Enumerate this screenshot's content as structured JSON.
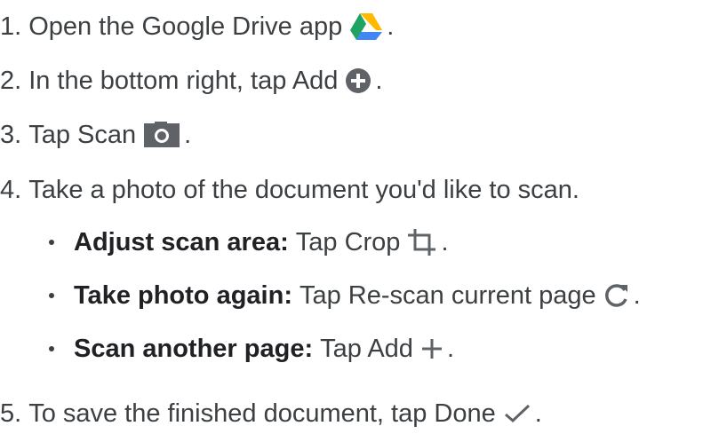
{
  "steps": [
    {
      "num": "1.",
      "text": "Open the Google Drive app",
      "icon": "google-drive-icon",
      "end": "."
    },
    {
      "num": "2.",
      "text": "In the bottom right, tap Add",
      "icon": "add-circle-icon",
      "end": "."
    },
    {
      "num": "3.",
      "text": "Tap Scan",
      "icon": "camera-icon",
      "end": "."
    },
    {
      "num": "4.",
      "text": "Take a photo of the document you'd like to scan.",
      "end": ""
    },
    {
      "num": "5.",
      "text": "To save the finished document, tap Done",
      "icon": "checkmark-icon",
      "end": "."
    }
  ],
  "bullets": [
    {
      "bold": "Adjust scan area:",
      "text": "Tap Crop",
      "icon": "crop-icon",
      "end": "."
    },
    {
      "bold": "Take photo again:",
      "text": "Tap Re-scan current page",
      "icon": "refresh-icon",
      "end": "."
    },
    {
      "bold": "Scan another page:",
      "text": "Tap Add",
      "icon": "plus-icon",
      "end": "."
    }
  ],
  "colors": {
    "text": "#3c4043",
    "icon_gray": "#5f6368",
    "drive_green": "#1ea362",
    "drive_yellow": "#ffba00",
    "drive_blue": "#4285f4"
  }
}
